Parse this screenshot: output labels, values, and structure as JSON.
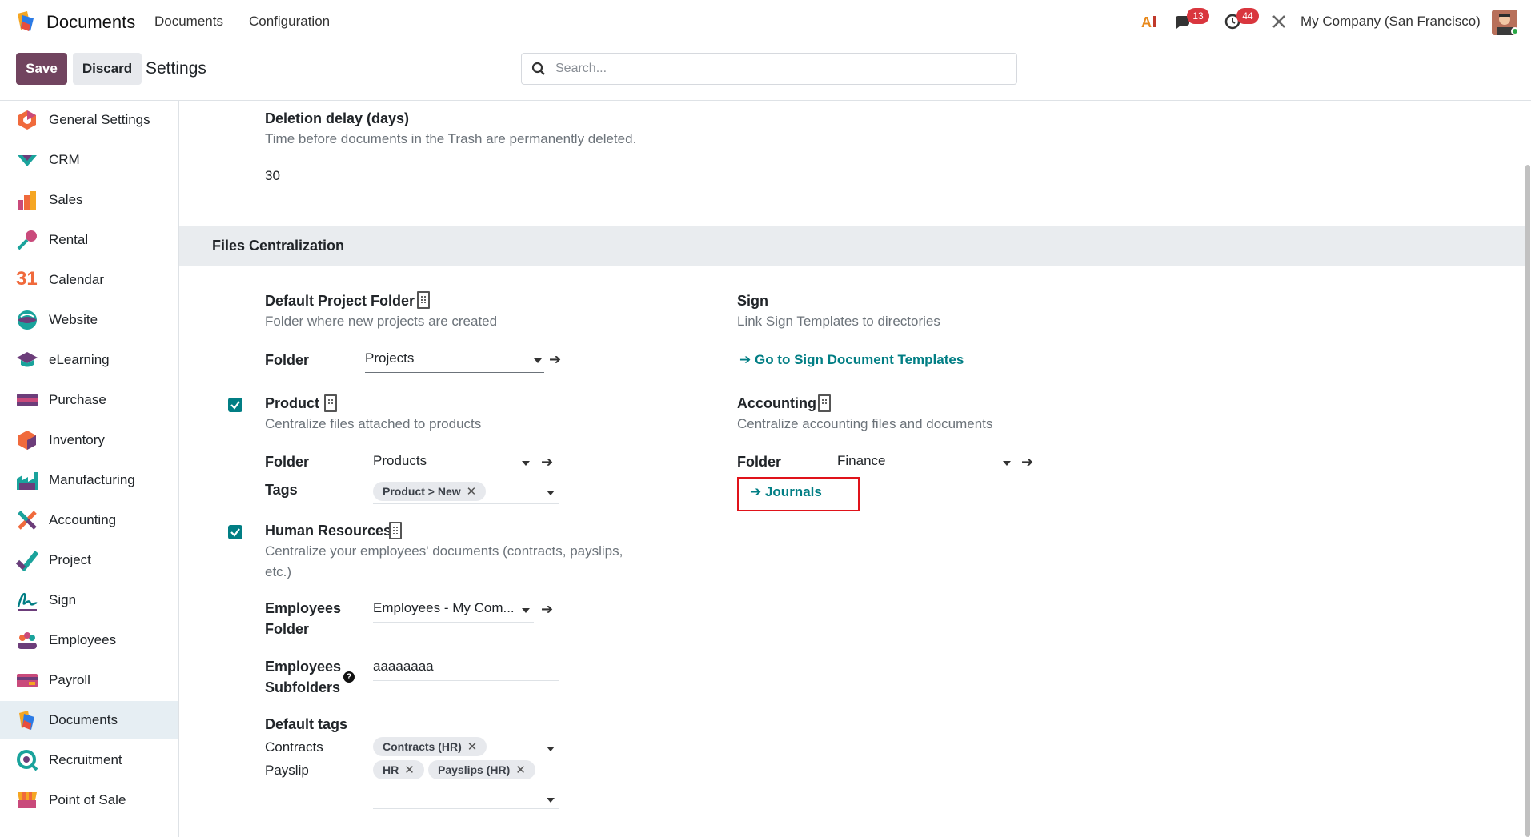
{
  "navbar": {
    "app_name": "Documents",
    "menus": [
      "Documents",
      "Configuration"
    ],
    "chat_count": "13",
    "activity_count": "44",
    "company": "My Company (San Francisco)"
  },
  "control_panel": {
    "save_label": "Save",
    "discard_label": "Discard",
    "title": "Settings",
    "search_placeholder": "Search..."
  },
  "sidebar": {
    "items": [
      {
        "label": "General Settings",
        "icon": "general-settings-icon"
      },
      {
        "label": "CRM",
        "icon": "crm-icon"
      },
      {
        "label": "Sales",
        "icon": "sales-icon"
      },
      {
        "label": "Rental",
        "icon": "rental-icon"
      },
      {
        "label": "Calendar",
        "icon": "calendar-icon"
      },
      {
        "label": "Website",
        "icon": "website-icon"
      },
      {
        "label": "eLearning",
        "icon": "elearning-icon"
      },
      {
        "label": "Purchase",
        "icon": "purchase-icon"
      },
      {
        "label": "Inventory",
        "icon": "inventory-icon"
      },
      {
        "label": "Manufacturing",
        "icon": "manufacturing-icon"
      },
      {
        "label": "Accounting",
        "icon": "accounting-icon"
      },
      {
        "label": "Project",
        "icon": "project-icon"
      },
      {
        "label": "Sign",
        "icon": "sign-icon"
      },
      {
        "label": "Employees",
        "icon": "employees-icon"
      },
      {
        "label": "Payroll",
        "icon": "payroll-icon"
      },
      {
        "label": "Documents",
        "icon": "documents-icon",
        "active": true
      },
      {
        "label": "Recruitment",
        "icon": "recruitment-icon"
      },
      {
        "label": "Point of Sale",
        "icon": "point-of-sale-icon"
      }
    ],
    "calendar_icon_text": "31"
  },
  "deletion": {
    "title": "Deletion delay (days)",
    "description": "Time before documents in the Trash are permanently deleted.",
    "value": "30"
  },
  "files_centralization": {
    "section_title": "Files Centralization",
    "project": {
      "title": "Default Project Folder",
      "description": "Folder where new projects are created",
      "folder_label": "Folder",
      "folder_value": "Projects"
    },
    "sign": {
      "title": "Sign",
      "description": "Link Sign Templates to directories",
      "link_label": "Go to Sign Document Templates"
    },
    "product": {
      "checked": true,
      "title": "Product",
      "description": "Centralize files attached to products",
      "folder_label": "Folder",
      "folder_value": "Products",
      "tags_label": "Tags",
      "tags": [
        "Product > New"
      ]
    },
    "accounting": {
      "title": "Accounting",
      "description": "Centralize accounting files and documents",
      "folder_label": "Folder",
      "folder_value": "Finance",
      "journals_label": "Journals"
    },
    "hr": {
      "checked": true,
      "title": "Human Resources",
      "description_line1": "Centralize your employees' documents (contracts, payslips,",
      "description_line2": "etc.)",
      "employees_folder_label_1": "Employees",
      "employees_folder_label_2": "Folder",
      "employees_folder_value": "Employees - My Com...",
      "subfolders_label_1": "Employees",
      "subfolders_label_2": "Subfolders",
      "subfolders_value": "aaaaaaaa",
      "default_tags_label": "Default tags",
      "contracts_label": "Contracts",
      "contracts_tags": [
        "Contracts (HR)"
      ],
      "payslip_label": "Payslip",
      "payslip_tags": [
        "HR",
        "Payslips (HR)"
      ]
    }
  },
  "colors": {
    "primary": "#71445f",
    "link": "#017e84",
    "badge": "#d9363e",
    "highlight": "#e0131a"
  }
}
